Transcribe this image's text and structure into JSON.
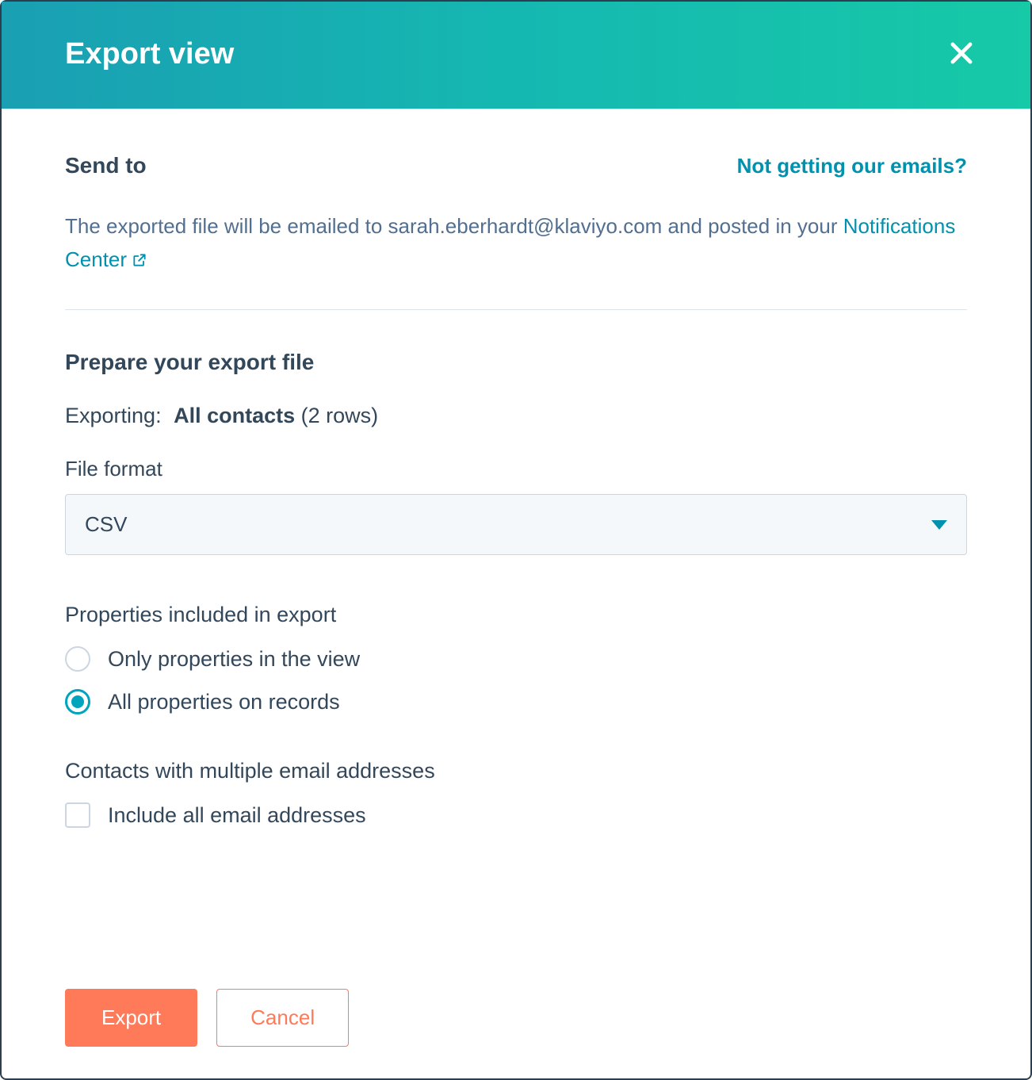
{
  "header": {
    "title": "Export view"
  },
  "sendTo": {
    "label": "Send to",
    "helpLink": "Not getting our emails?",
    "description_prefix": "The exported file will be emailed to ",
    "email": "sarah.eberhardt@klaviyo.com",
    "description_mid": " and posted in your ",
    "notifications_link": "Notifications Center"
  },
  "prepare": {
    "title": "Prepare your export file",
    "exporting_label": "Exporting:",
    "exporting_value": "All contacts",
    "exporting_count": "(2 rows)",
    "file_format_label": "File format",
    "file_format_selected": "CSV"
  },
  "properties": {
    "title": "Properties included in export",
    "options": [
      {
        "label": "Only properties in the view",
        "selected": false
      },
      {
        "label": "All properties on records",
        "selected": true
      }
    ]
  },
  "multipleEmails": {
    "title": "Contacts with multiple email addresses",
    "checkbox_label": "Include all email addresses",
    "checked": false
  },
  "footer": {
    "export_label": "Export",
    "cancel_label": "Cancel"
  }
}
